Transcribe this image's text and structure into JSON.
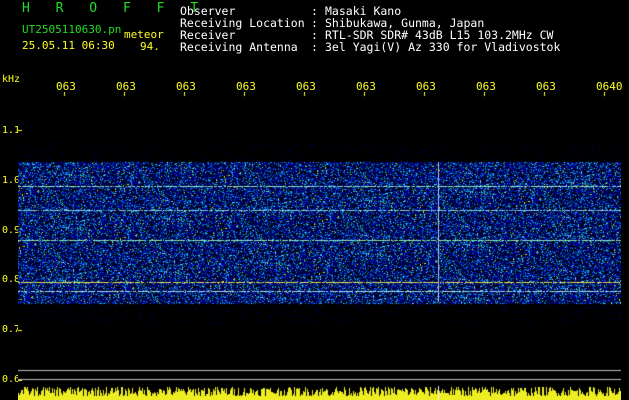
{
  "header": {
    "brand": "H R O F F T",
    "filename": "UT2505110630.pn",
    "datetime": "25.05.11 06:30",
    "meteor_label": "meteor",
    "meteor_count": "94."
  },
  "info": [
    {
      "key": "Observer",
      "value": "Masaki Kano"
    },
    {
      "key": "Receiving Location",
      "value": "Shibukawa, Gunma, Japan"
    },
    {
      "key": "Receiver",
      "value": "RTL-SDR SDR# 43dB L15 103.2MHz CW"
    },
    {
      "key": "Receiving Antenna",
      "value": "3el Yagi(V) Az 330 for Vladivostok"
    }
  ],
  "info_colon": ":",
  "axes": {
    "y_unit": "kHz",
    "y_ticks": [
      "1.1",
      "1.0",
      "0.9",
      "0.8",
      "0.7",
      "0.6"
    ],
    "x_ticks": [
      "063",
      "063",
      "063",
      "063",
      "063",
      "063",
      "063",
      "063",
      "063",
      "0640"
    ]
  },
  "colors": {
    "header_green": "#22dd22",
    "axis_yellow": "#ffff22",
    "info_white": "#ffffff"
  }
}
